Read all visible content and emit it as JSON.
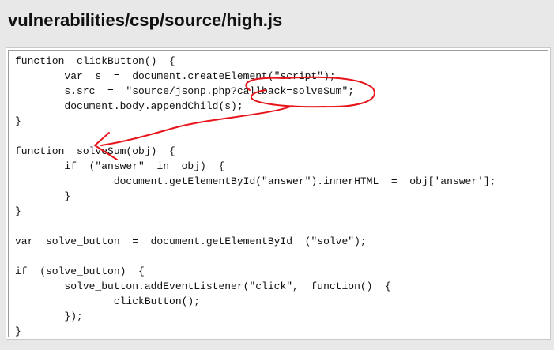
{
  "page": {
    "title": "vulnerabilities/csp/source/high.js"
  },
  "code": {
    "lines": [
      "function  clickButton()  {",
      "        var  s  =  document.createElement(\"script\");",
      "        s.src  =  \"source/jsonp.php?callback=solveSum\";",
      "        document.body.appendChild(s);",
      "}",
      "",
      "function  solveSum(obj)  {",
      "        if  (\"answer\"  in  obj)  {",
      "                document.getElementById(\"answer\").innerHTML  =  obj['answer'];",
      "        }",
      "}",
      "",
      "var  solve_button  =  document.getElementById  (\"solve\");",
      "",
      "if  (solve_button)  {",
      "        solve_button.addEventListener(\"click\",  function()  {",
      "                clickButton();",
      "        });",
      "}"
    ]
  },
  "annotation": {
    "color": "#e8141b"
  }
}
